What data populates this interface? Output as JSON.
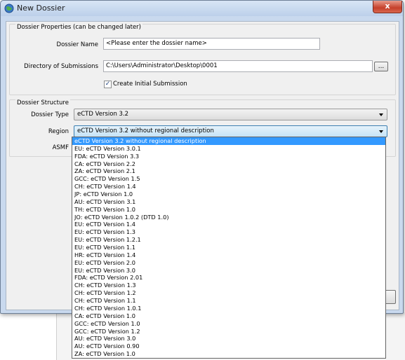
{
  "window": {
    "title": "New Dossier",
    "close_label": "x"
  },
  "properties": {
    "group_title": "Dossier Properties (can be changed later)",
    "name_label": "Dossier Name",
    "name_value": "<Please enter the dossier name>",
    "dir_label": "Directory of Submissions",
    "dir_value": "C:\\Users\\Administrator\\Desktop\\0001",
    "browse_label": "...",
    "create_initial_label": "Create Initial Submission",
    "create_initial_checked": true,
    "check_mark": "✓"
  },
  "structure": {
    "group_title": "Dossier Structure",
    "type_label": "Dossier Type",
    "type_value": "eCTD Version 3.2",
    "region_label": "Region",
    "region_value": "eCTD Version 3.2 without regional description",
    "asmf_label": "ASMF"
  },
  "dropdown": {
    "items": [
      {
        "code": "",
        "text": "eCTD Version 3.2 without regional description",
        "selected": true
      },
      {
        "code": "EU:",
        "text": "eCTD Version 3.0.1"
      },
      {
        "code": "FDA:",
        "text": "eCTD Version 3.3"
      },
      {
        "code": "CA:",
        "text": "eCTD Version 2.2"
      },
      {
        "code": "ZA:",
        "text": "eCTD Version 2.1"
      },
      {
        "code": "GCC:",
        "text": "eCTD Version 1.5"
      },
      {
        "code": "CH:",
        "text": "eCTD Version 1.4"
      },
      {
        "code": "JP:",
        "text": "eCTD Version 1.0"
      },
      {
        "code": "AU:",
        "text": "eCTD Version 3.1"
      },
      {
        "code": "TH:",
        "text": "eCTD Version 1.0"
      },
      {
        "code": "JO:",
        "text": "eCTD Version 1.0.2 (DTD 1.0)"
      },
      {
        "code": "EU:",
        "text": "eCTD Version 1.4"
      },
      {
        "code": "EU:",
        "text": "eCTD Version 1.3"
      },
      {
        "code": "EU:",
        "text": "eCTD Version 1.2.1"
      },
      {
        "code": "EU:",
        "text": "eCTD Version 1.1"
      },
      {
        "code": "HR:",
        "text": "eCTD Version 1.4"
      },
      {
        "code": "EU:",
        "text": "eCTD Version 2.0"
      },
      {
        "code": "EU:",
        "text": "eCTD Version 3.0"
      },
      {
        "code": "FDA:",
        "text": "eCTD Version 2.01"
      },
      {
        "code": "CH:",
        "text": "eCTD Version 1.3"
      },
      {
        "code": "CH:",
        "text": "eCTD Version 1.2"
      },
      {
        "code": "CH:",
        "text": "eCTD Version 1.1"
      },
      {
        "code": "CH:",
        "text": "eCTD Version 1.0.1"
      },
      {
        "code": "CA:",
        "text": "eCTD Version 1.0"
      },
      {
        "code": "GCC:",
        "text": "eCTD Version 1.0"
      },
      {
        "code": "GCC:",
        "text": "eCTD Version 1.2"
      },
      {
        "code": "AU:",
        "text": "eCTD Version 3.0"
      },
      {
        "code": "AU:",
        "text": "eCTD Version 0.90"
      },
      {
        "code": "ZA:",
        "text": "eCTD Version 1.0"
      }
    ]
  },
  "colors": {
    "selection": "#3399ff",
    "titlebar": "#c9d9ee",
    "close": "#c5402b"
  }
}
